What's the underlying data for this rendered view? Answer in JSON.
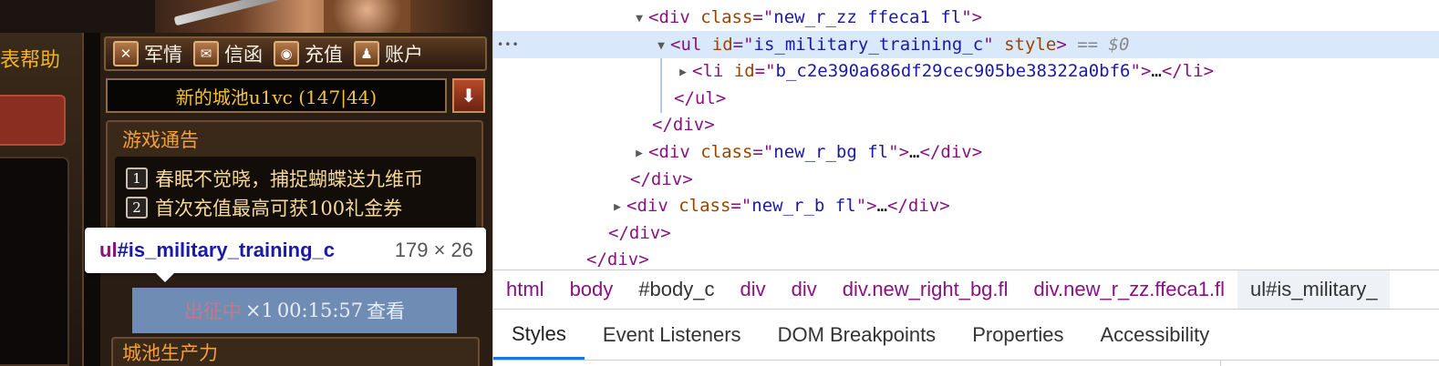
{
  "game": {
    "help_label": "表帮助",
    "menu": [
      {
        "icon": "crossed-swords-icon",
        "glyph": "✕",
        "label": "军情"
      },
      {
        "icon": "envelope-icon",
        "glyph": "✉",
        "label": "信函"
      },
      {
        "icon": "coin-icon",
        "glyph": "◉",
        "label": "充值"
      },
      {
        "icon": "user-icon",
        "glyph": "♟",
        "label": "账户"
      }
    ],
    "city_name": "新的城池u1vc (147|44)",
    "notice_title": "游戏通告",
    "notices": [
      {
        "num": "1",
        "text": "春眠不觉晓，捕捉蝴蝶送九维币"
      },
      {
        "num": "2",
        "text": "首次充值最高可获100礼金券"
      }
    ],
    "training": {
      "status": "出征中",
      "count": "×1",
      "time": "00:15:57",
      "action": "查看"
    },
    "production_title": "城池生产力"
  },
  "tooltip": {
    "tag": "ul",
    "selector": "#is_military_training_c",
    "dims": "179 × 26"
  },
  "devtools": {
    "dom": [
      {
        "indent": 150,
        "tri": "▼",
        "tag": "div",
        "attr": "class",
        "value": "new_r_zz ffeca1 fl",
        "close": false
      },
      {
        "indent": 174,
        "tri": "▼",
        "tag": "ul",
        "attr": "id",
        "value": "is_military_training_c",
        "extra_attr": "style",
        "suffix": "== $0",
        "selected": true
      },
      {
        "indent": 198,
        "tri": "▶",
        "tag": "li",
        "attr": "id",
        "value": "b_c2e390a686df29cec905be38322a0bf6",
        "inner": "…",
        "close_tag": "li"
      },
      {
        "indent": 198,
        "closing": "ul"
      },
      {
        "indent": 174,
        "closing": "div"
      },
      {
        "indent": 150,
        "tri": "▶",
        "tag": "div",
        "attr": "class",
        "value": "new_r_bg fl",
        "inner": "…",
        "close_tag": "div"
      },
      {
        "indent": 150,
        "closing": "div"
      },
      {
        "indent": 126,
        "tri": "▶",
        "tag": "div",
        "attr": "class",
        "value": "new_r_b fl",
        "inner": "…",
        "close_tag": "div"
      },
      {
        "indent": 126,
        "closing": "div"
      },
      {
        "indent": 102,
        "closing": "div"
      }
    ],
    "breadcrumbs": [
      "html",
      "body",
      "#body_c",
      "div",
      "div",
      "div.new_right_bg.fl",
      "div.new_r_zz.ffeca1.fl",
      "ul#is_military_"
    ],
    "tabs": [
      "Styles",
      "Event Listeners",
      "DOM Breakpoints",
      "Properties",
      "Accessibility"
    ],
    "active_tab": "Styles",
    "more_dots": "…"
  }
}
